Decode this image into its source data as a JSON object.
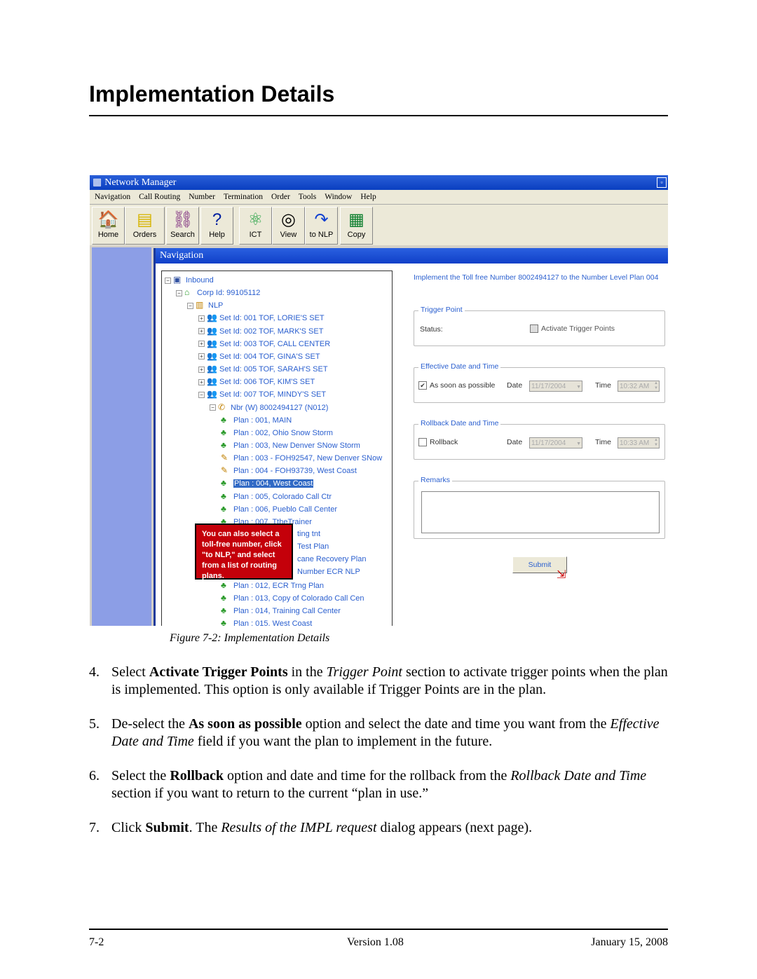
{
  "heading": "Implementation Details",
  "app": {
    "title": "Network Manager",
    "menu": [
      "Navigation",
      "Call Routing",
      "Number",
      "Termination",
      "Order",
      "Tools",
      "Window",
      "Help"
    ],
    "toolbar": [
      {
        "label": "Home",
        "icon": "home-icon"
      },
      {
        "label": "Orders",
        "icon": "orders-icon"
      },
      {
        "label": "Search",
        "icon": "binoculars-icon"
      },
      {
        "label": "Help",
        "icon": "help-icon"
      },
      {
        "label": "ICT",
        "icon": "molecule-icon"
      },
      {
        "label": "View",
        "icon": "glasses-icon"
      },
      {
        "label": "to NLP",
        "icon": "arrow-icon"
      },
      {
        "label": "Copy",
        "icon": "copy-icon"
      }
    ],
    "nav_header": "Navigation",
    "tree": [
      {
        "label": "Inbound",
        "level": 0,
        "exp": "-"
      },
      {
        "label": "Corp Id: 99105112",
        "level": 1,
        "exp": "-"
      },
      {
        "label": "NLP",
        "level": 2,
        "exp": "-"
      },
      {
        "label": "Set Id:  001 TOF, LORIE'S SET",
        "level": 3,
        "exp": "+"
      },
      {
        "label": "Set Id:  002 TOF, MARK'S SET",
        "level": 3,
        "exp": "+"
      },
      {
        "label": "Set Id:  003 TOF, CALL CENTER",
        "level": 3,
        "exp": "+"
      },
      {
        "label": "Set Id:  004 TOF, GINA'S SET",
        "level": 3,
        "exp": "+"
      },
      {
        "label": "Set Id:  005 TOF, SARAH'S SET",
        "level": 3,
        "exp": "+"
      },
      {
        "label": "Set Id:  006 TOF, KIM'S SET",
        "level": 3,
        "exp": "+"
      },
      {
        "label": "Set Id:  007 TOF, MINDY'S SET",
        "level": 3,
        "exp": "-"
      },
      {
        "label": "Nbr (W) 8002494127 (N012)",
        "level": 4,
        "exp": "-"
      },
      {
        "label": "Plan : 001, MAIN",
        "level": 5
      },
      {
        "label": "Plan : 002, Ohio Snow Storm",
        "level": 5
      },
      {
        "label": "Plan : 003, New Denver SNow Storm",
        "level": 5
      },
      {
        "label": "Plan : 003 - FOH92547, New Denver SNow",
        "level": 5,
        "pending": true
      },
      {
        "label": "Plan : 004 - FOH93739, West Coast",
        "level": 5,
        "pending": true
      },
      {
        "label": "Plan : 004, West Coast",
        "level": 5,
        "selected": true
      },
      {
        "label": "Plan : 005, Colorado Call Ctr",
        "level": 5
      },
      {
        "label": "Plan : 006, Pueblo Call Center",
        "level": 5
      },
      {
        "label": "Plan : 007, TtheTrainer",
        "level": 5
      },
      {
        "label": "ting tnt",
        "level": 5
      },
      {
        "label": "Test Plan",
        "level": 5
      },
      {
        "label": "cane Recovery Plan",
        "level": 5
      },
      {
        "label": "Number ECR NLP",
        "level": 5
      },
      {
        "label": "Plan : 012, ECR Trng Plan",
        "level": 5
      },
      {
        "label": "Plan : 013, Copy of Colorado Call Cen",
        "level": 5
      },
      {
        "label": "Plan : 014, Training Call Center",
        "level": 5
      },
      {
        "label": "Plan : 015, West Coast",
        "level": 5
      }
    ],
    "callout": "You can also select a toll-free number, click \"to NLP,\" and select from a list of routing plans.",
    "implement_text": "Implement the Toll free Number 8002494127 to the Number Level Plan 004",
    "trigger": {
      "legend": "Trigger Point",
      "status_label": "Status:",
      "checkbox_label": "Activate Trigger Points",
      "checked": false
    },
    "effective": {
      "legend": "Effective Date and Time",
      "checkbox_label": "As soon as possible",
      "checked": true,
      "date_label": "Date",
      "date": "11/17/2004",
      "time_label": "Time",
      "time": "10:32 AM"
    },
    "rollback": {
      "legend": "Rollback Date and Time",
      "checkbox_label": "Rollback",
      "checked": false,
      "date_label": "Date",
      "date": "11/17/2004",
      "time_label": "Time",
      "time": "10:33 AM"
    },
    "remarks": {
      "legend": "Remarks",
      "value": ""
    },
    "submit": "Submit"
  },
  "caption": "Figure 7-2:   Implementation Details",
  "steps": [
    {
      "n": "4.",
      "html": "Select <b>Activate Trigger Points</b> in the <i>Trigger Point</i> section to activate trigger points when the plan is implemented. This option is only available if Trigger Points are in the plan."
    },
    {
      "n": "5.",
      "html": "De-select the <b>As soon as possible</b> option and select the date and time you want from the <i>Effective Date and Time</i> field if you want the plan to implement in the future."
    },
    {
      "n": "6.",
      "html": "Select the <b>Rollback</b> option and date and time for the rollback from the <i>Rollback Date and Time</i> section if you want to return to the current “plan in use.”"
    },
    {
      "n": "7.",
      "html": "Click <b>Submit</b>. The <i>Results of the IMPL request</i> dialog appears (next page)."
    }
  ],
  "footer": {
    "left": "7-2",
    "center": "Version 1.08",
    "right": "January 15, 2008"
  }
}
